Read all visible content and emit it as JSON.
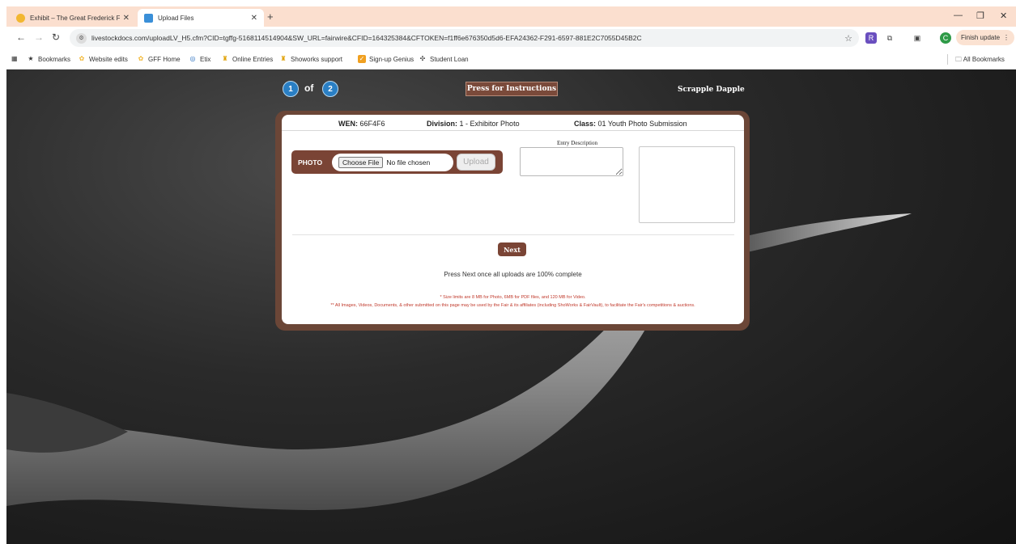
{
  "browser": {
    "tabs": [
      {
        "title": "Exhibit – The Great Frederick Fa",
        "active": false
      },
      {
        "title": "Upload Files",
        "active": true
      }
    ],
    "address": "livestockdocs.com/uploadLV_H5.cfm?CID=tgffg-5168114514904&SW_URL=fairwire&CFID=164325384&CFTOKEN=f1ff6e676350d5d6-EFA24362-F291-6597-881E2C7055D45B2C",
    "finish_update": "Finish update",
    "profile_initial": "C",
    "bookmarks": [
      "Bookmarks",
      "Website edits",
      "GFF Home",
      "Etix",
      "Online Entries",
      "Showorks support",
      "Sign-up Genius",
      "Student Loan"
    ],
    "all_bookmarks": "All Bookmarks"
  },
  "steps": {
    "current": "1",
    "of": "of",
    "total": "2"
  },
  "instructions_button": "Press for Instructions",
  "entrant_name": "Scrapple Dapple",
  "info": {
    "wen_label": "WEN:",
    "wen_value": "66F4F6",
    "division_label": "Division:",
    "division_value": "1 - Exhibitor Photo",
    "class_label": "Class:",
    "class_value": "01 Youth Photo Submission"
  },
  "upload": {
    "label": "PHOTO",
    "choose_file": "Choose File",
    "no_file": "No file chosen",
    "upload_button": "Upload"
  },
  "entry_description_label": "Entry Description",
  "next_button": "Next",
  "press_next_text": "Press Next once all uploads are 100% complete",
  "notes": [
    "* Size limits are 8 MB for Photo, 6MB for PDF files, and 120 MB for Video.",
    "** All Images, Videos, Documents, & other submitted on this page may be used by the Fair & its affiliates (including ShoWorks & FairVault), to facilitate the Fair's competitions & auctions."
  ]
}
